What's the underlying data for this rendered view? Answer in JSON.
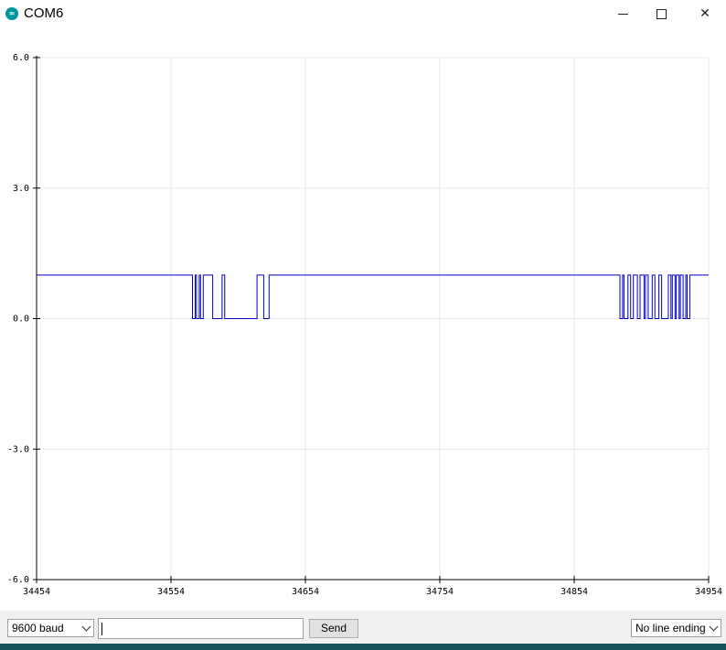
{
  "window": {
    "title": "COM6",
    "icon": "arduino-icon",
    "controls": [
      "minimize-icon",
      "maximize-icon",
      "close-icon"
    ]
  },
  "chart_data": {
    "type": "line",
    "title": "",
    "xlabel": "",
    "ylabel": "",
    "xlim": [
      34454,
      34954
    ],
    "ylim": [
      -6.0,
      6.0
    ],
    "x_ticks": [
      "34454",
      "34554",
      "34654",
      "34754",
      "34854",
      "34954"
    ],
    "y_ticks": [
      "6.0",
      "3.0",
      "0.0",
      "-3.0",
      "-6.0"
    ],
    "grid": true,
    "series_color": "#0000c8",
    "series": [
      {
        "name": "",
        "x": [
          34454,
          34570,
          34570,
          34572,
          34572,
          34573,
          34573,
          34575,
          34575,
          34576,
          34576,
          34578,
          34578,
          34585,
          34585,
          34592,
          34592,
          34594,
          34594,
          34596,
          34596,
          34618,
          34618,
          34623,
          34623,
          34627,
          34627,
          34888,
          34888,
          34890,
          34890,
          34891,
          34891,
          34894,
          34894,
          34896,
          34896,
          34898,
          34898,
          34901,
          34901,
          34903,
          34903,
          34906,
          34906,
          34907,
          34907,
          34909,
          34909,
          34912,
          34912,
          34914,
          34914,
          34917,
          34917,
          34919,
          34919,
          34924,
          34924,
          34926,
          34926,
          34927,
          34927,
          34929,
          34929,
          34930,
          34930,
          34932,
          34932,
          34933,
          34933,
          34935,
          34935,
          34937,
          34937,
          34938,
          34938,
          34940,
          34940,
          34954
        ],
        "y": [
          1,
          1,
          0,
          0,
          1,
          1,
          0,
          0,
          1,
          1,
          0,
          0,
          1,
          1,
          0,
          0,
          1,
          1,
          0,
          0,
          0,
          0,
          1,
          1,
          0,
          0,
          1,
          1,
          0,
          0,
          1,
          1,
          0,
          0,
          1,
          1,
          0,
          0,
          1,
          1,
          0,
          0,
          1,
          1,
          0,
          0,
          1,
          1,
          0,
          0,
          1,
          1,
          0,
          0,
          1,
          1,
          0,
          0,
          1,
          1,
          0,
          0,
          1,
          1,
          0,
          0,
          1,
          1,
          0,
          0,
          1,
          1,
          0,
          0,
          1,
          1,
          0,
          0,
          1,
          1
        ]
      }
    ]
  },
  "controls": {
    "baud_value": "9600 baud",
    "input_value": "",
    "send_label": "Send",
    "line_ending_value": "No line ending"
  }
}
